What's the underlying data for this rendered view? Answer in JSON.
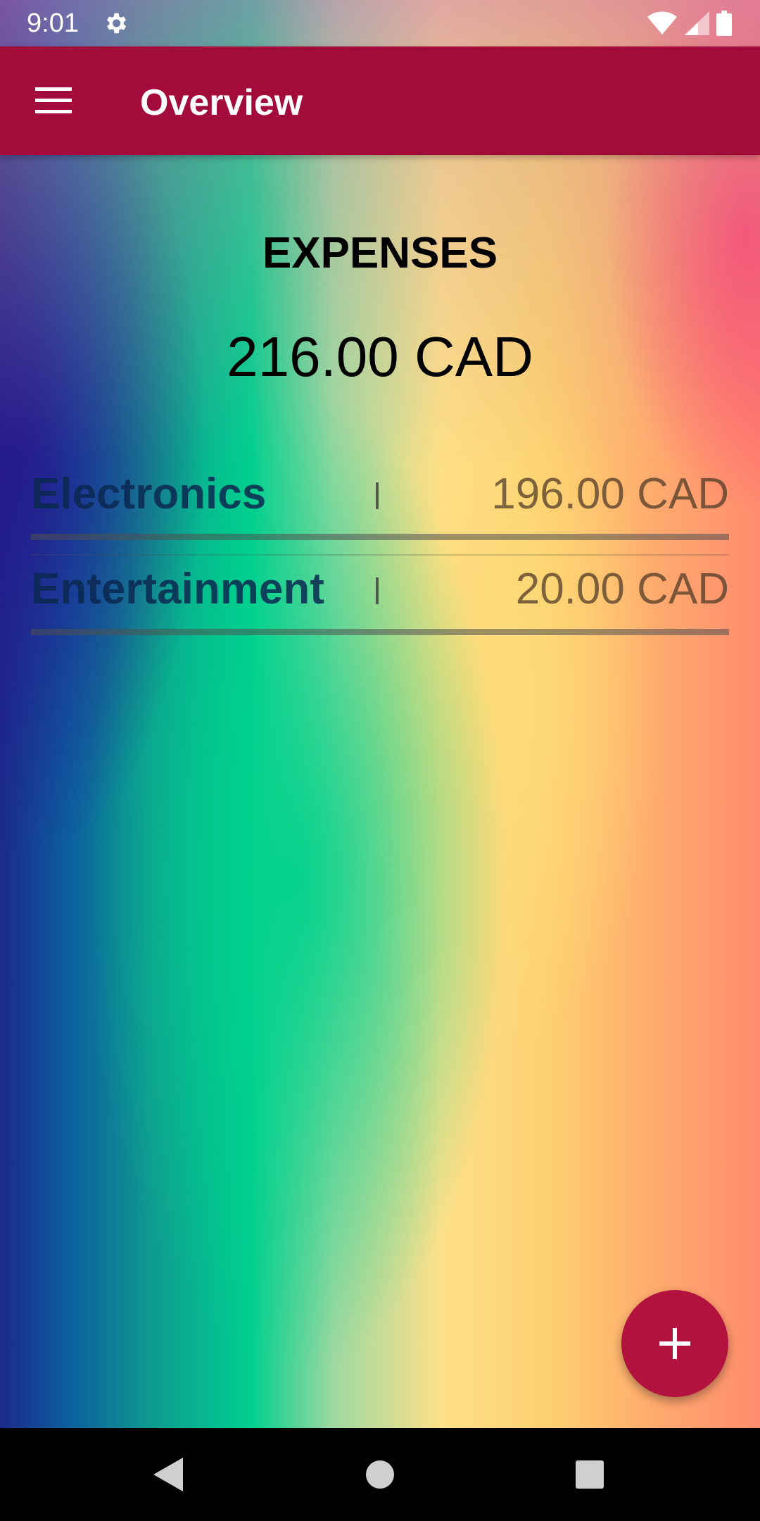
{
  "status_bar": {
    "time": "9:01",
    "icons": [
      "settings-icon",
      "wifi-icon",
      "signal-icon",
      "battery-icon"
    ]
  },
  "app_bar": {
    "menu_icon": "menu-icon",
    "title": "Overview",
    "background_color": "#a30b3a"
  },
  "summary": {
    "heading": "EXPENSES",
    "total": "216.00 CAD"
  },
  "categories": [
    {
      "name": "Electronics",
      "separator": "|",
      "amount": "196.00 CAD"
    },
    {
      "name": "Entertainment",
      "separator": "|",
      "amount": "20.00 CAD"
    }
  ],
  "fab": {
    "icon": "plus-icon",
    "color": "#b3123f"
  },
  "nav_bar": {
    "buttons": [
      "back-icon",
      "home-icon",
      "recents-icon"
    ]
  }
}
